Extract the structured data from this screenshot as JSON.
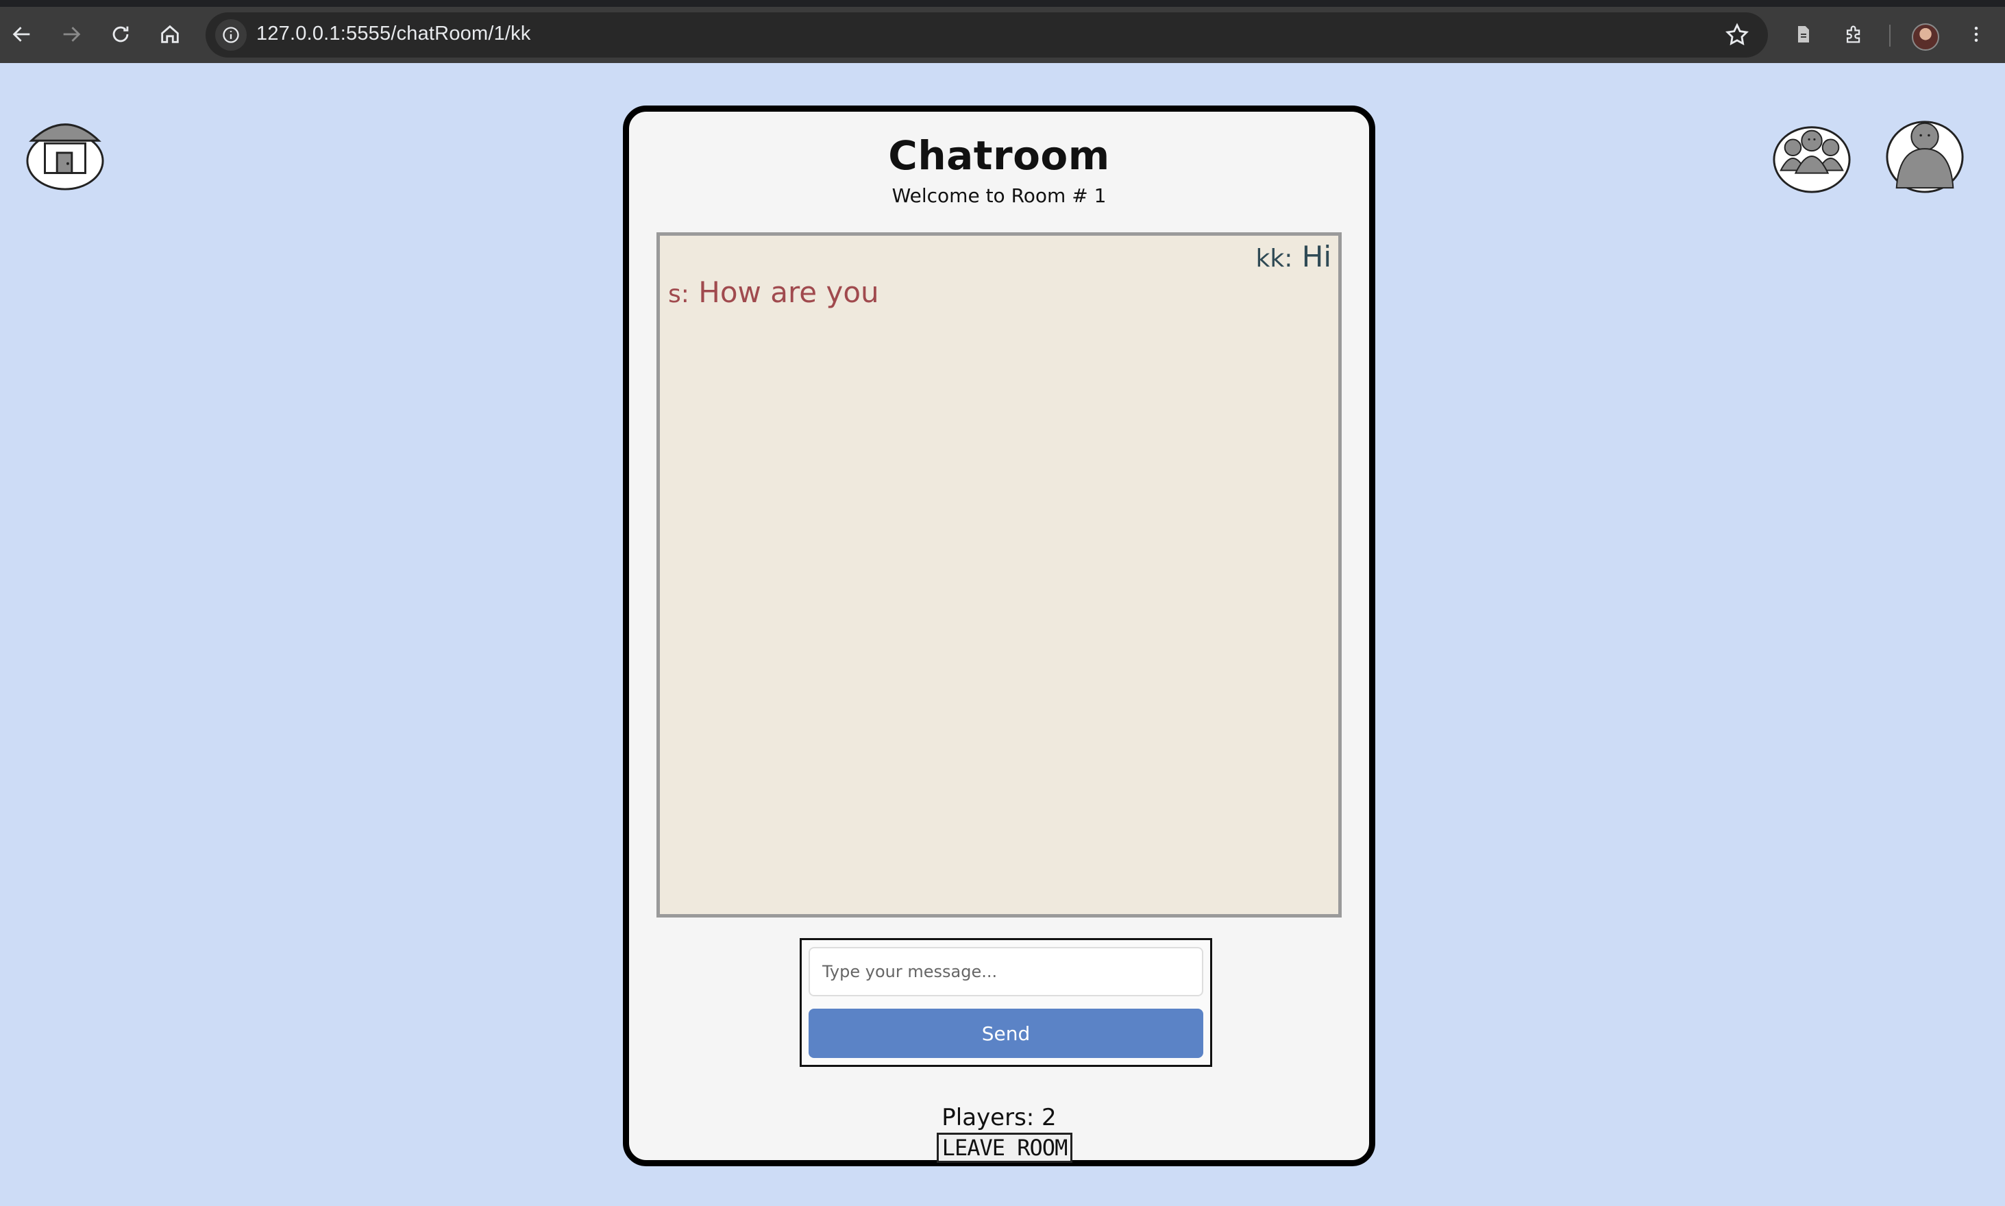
{
  "browser": {
    "url": "127.0.0.1:5555/chatRoom/1/kk"
  },
  "chatroom": {
    "title": "Chatroom",
    "subtitle": "Welcome to Room # 1",
    "messages": [
      {
        "sender": "kk:",
        "text": "Hi",
        "align": "right",
        "color": "#2f4a55"
      },
      {
        "sender": "s:",
        "text": "How are you",
        "align": "left",
        "color": "#a04a4e"
      }
    ],
    "input_placeholder": "Type your message...",
    "send_label": "Send",
    "players_label": "Players: 2",
    "leave_label": "LEAVE ROOM"
  },
  "colors": {
    "page_bg": "#cddcf6",
    "card_bg": "#f5f5f5",
    "messages_bg": "#efe9dd",
    "send_button": "#5b83c6"
  },
  "icons": [
    "back-icon",
    "forward-icon",
    "reload-icon",
    "home-browser-icon",
    "site-info-icon",
    "bookmark-star-icon",
    "reading-list-icon",
    "extensions-icon",
    "profile-avatar-icon",
    "menu-icon",
    "home-hut-icon",
    "friends-icon",
    "profile-icon"
  ]
}
